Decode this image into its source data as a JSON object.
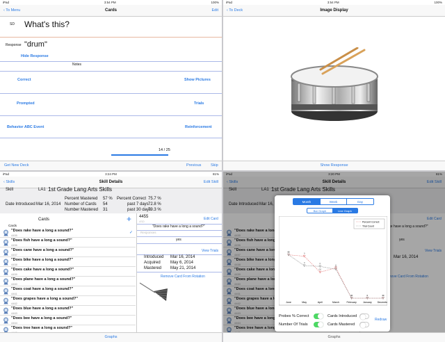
{
  "status": {
    "ipad": "iPad",
    "t1": "3:54 PM",
    "t2": "3:54 PM",
    "t3": "3:24 PM",
    "t4": "3:20 PM",
    "b1": "100%",
    "b2": "100%",
    "b3": "81%",
    "b4": "81%"
  },
  "cards": {
    "back": "To Menu",
    "title": "Cards",
    "edit": "Edit",
    "sd_label": "SD",
    "sd_text": "What's this?",
    "response_label": "Response",
    "response_text": "\"drum\"",
    "hide": "Hide Response",
    "notes": "Notes",
    "correct": "Correct",
    "show_pictures": "Show Pictures",
    "prompted": "Prompted",
    "trials": "Trials",
    "behavior": "Behavior ABC Event",
    "reinforcement": "Reinforcement",
    "counter": "14 / 25",
    "get_new_deck": "Get New Deck",
    "previous": "Previous",
    "skip": "Skip"
  },
  "image": {
    "back": "To Deck",
    "title": "Image Display",
    "show_response": "Show Response"
  },
  "skill": {
    "back": "Skills",
    "title": "Skill Details",
    "edit": "Edit Skill",
    "skill_label": "Skill",
    "skill_code": "LA1",
    "skill_name": "1st Grade Lang Arts Skills",
    "date_label": "Date Introduced",
    "date_value": "Mar 16, 2014",
    "pm_label": "Percent Mastered",
    "pm_value": "57 %",
    "nc_label": "Number of Cards",
    "nc_value": "54",
    "nm_label": "Number Mastered",
    "nm_value": "31",
    "pc_label": "Percent Correct",
    "pc_value": "75.7 %",
    "p7_label": "past 7 days",
    "p7_value": "72.8 %",
    "p30_label": "past 30 days",
    "p30_value": "79.3 %",
    "cards_header": "Cards",
    "cards_sub": "Cards",
    "plus": "+",
    "check": "✓",
    "rows": [
      {
        "text": "\"Does rake have a long a sound?\"",
        "id": "4455"
      },
      {
        "text": "\"Does fish have a long a sound?\"",
        "id": "4456"
      },
      {
        "text": "\"Does cane have a long a sound?\"",
        "id": "4457"
      },
      {
        "text": "\"Does bike have a long a sound?\"",
        "id": "4458"
      },
      {
        "text": "\"Does cake have a long a sound?\"",
        "id": "4459"
      },
      {
        "text": "\"Does plane have a long a sound?\"",
        "id": "4460"
      },
      {
        "text": "\"Does coat have a long a sound?\"",
        "id": "4461"
      },
      {
        "text": "\"Does grapes have a long a sound?\"",
        "id": "4462"
      },
      {
        "text": "\"Does blue have a long a sound?\"",
        "id": "4463"
      },
      {
        "text": "\"Does bee have a long a sound?\"",
        "id": "4464"
      },
      {
        "text": "\"Does tree have a long a sound?\"",
        "id": "4465"
      }
    ],
    "detail_id": "4455",
    "edit_card": "Edit Card",
    "detail_q": "\"Does rake have a long a sound?\"",
    "detail_sid": "4SD",
    "responses": "Responses",
    "yes": "yes",
    "view_trials": "View Trials",
    "intro_label": "Introduced",
    "intro_value": "Mar 16, 2014",
    "acq_label": "Acquired",
    "acq_value": "May 6, 2014",
    "mast_label": "Mastered",
    "mast_value": "May 21, 2014",
    "remove": "Remove Card From Rotation",
    "graphs": "Graphs"
  },
  "graph": {
    "seg1": [
      "Month",
      "Week",
      "Day"
    ],
    "seg2": [
      "Bar Graph",
      "Line Graph"
    ],
    "legend": [
      "Percent Correct",
      "Trial Count"
    ],
    "probes": "Probes % Correct",
    "trials": "Number Of Trials",
    "cards_intro": "Cards Introduced",
    "cards_mastered": "Cards Mastered",
    "redraw": "Redraw",
    "bg_yes": "yes",
    "bg_view": "View Trials",
    "bg_remove": "Remove Card From Rotation",
    "bg_intro": "Mar 16, 2014"
  },
  "chart_data": {
    "type": "line",
    "categories": [
      "June",
      "May",
      "April",
      "March",
      "February",
      "January",
      "December"
    ],
    "series": [
      {
        "name": "Percent Correct",
        "values": [
          60,
          58,
          36,
          42,
          0,
          0,
          0
        ]
      },
      {
        "name": "Trial Count",
        "values": [
          60,
          45,
          44,
          40,
          0,
          0,
          0
        ]
      }
    ],
    "ylim": [
      0,
      100
    ],
    "xlabel": "",
    "ylabel": "",
    "title": "",
    "point_labels": [
      "00",
      "0",
      "00",
      "0",
      "00",
      "0",
      "00",
      "0",
      "0",
      "0",
      "0",
      "0",
      "0",
      "0"
    ],
    "legend_position": "top-right",
    "grid": false
  },
  "colors": {
    "accent": "#2a7ae4",
    "toggle_on": "#4cd964",
    "pc": "#e07070",
    "tc": "#888888"
  }
}
